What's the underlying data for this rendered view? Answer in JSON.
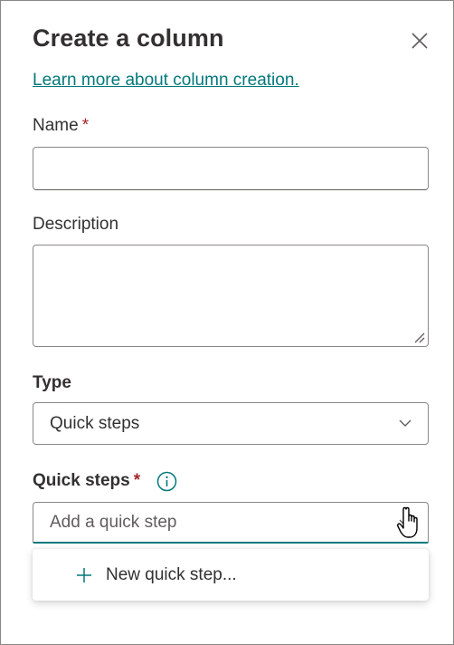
{
  "dialog": {
    "title": "Create a column",
    "learn_more_link": "Learn more about column creation."
  },
  "fields": {
    "name": {
      "label": "Name",
      "required_mark": "*",
      "value": ""
    },
    "description": {
      "label": "Description",
      "value": ""
    },
    "type": {
      "label": "Type",
      "selected": "Quick steps"
    },
    "quick_steps": {
      "label": "Quick steps",
      "required_mark": "*",
      "placeholder": "Add a quick step"
    }
  },
  "menu": {
    "items": [
      {
        "label": "New quick step...",
        "icon": "plus-icon"
      }
    ]
  },
  "colors": {
    "accent": "#03787c",
    "required": "#a4262c",
    "text": "#323130",
    "border": "#8a8886"
  },
  "icons": [
    "close-icon",
    "info-icon",
    "chevron-down-icon",
    "plus-icon",
    "hand-cursor-icon",
    "resize-grip-icon"
  ]
}
